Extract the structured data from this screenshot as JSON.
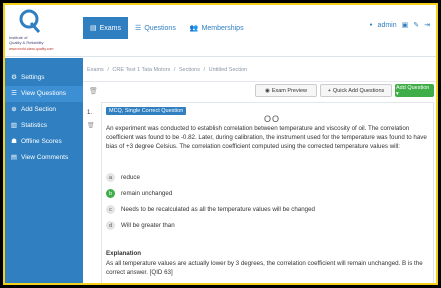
{
  "logo": {
    "line1": "Institute of",
    "line2": "Quality & Reliability",
    "url": "www.world-class-quality.com"
  },
  "nav": {
    "items": [
      {
        "label": "Exams",
        "icon": "clipboard-icon",
        "active": true
      },
      {
        "label": "Questions",
        "icon": "list-icon",
        "active": false
      },
      {
        "label": "Memberships",
        "icon": "users-icon",
        "active": false
      }
    ]
  },
  "user": {
    "name": "admin"
  },
  "sidebar": {
    "items": [
      {
        "label": "Settings",
        "icon": "gear-icon",
        "active": false
      },
      {
        "label": "View Questions",
        "icon": "list-icon",
        "active": true
      },
      {
        "label": "Add Section",
        "icon": "plus-circle-icon",
        "active": false
      },
      {
        "label": "Statistics",
        "icon": "chart-icon",
        "active": false
      },
      {
        "label": "Offline Scores",
        "icon": "users-icon",
        "active": false
      },
      {
        "label": "View Comments",
        "icon": "comment-icon",
        "active": false
      }
    ]
  },
  "breadcrumb": [
    "Exams",
    "/",
    "CRE Test 1 Tata Motors",
    "/",
    "Sections",
    "/",
    "Untitled Section"
  ],
  "toolbar": {
    "preview_label": "Exam Preview",
    "quick_add_label": "Quick Add Questions",
    "add_question_label": "Add Question ▾"
  },
  "question": {
    "number": "1.",
    "type_badge": "MCQ, Single Correct Question",
    "glyph": "OO",
    "text": "An experiment was conducted to establish correlation between temperature and viscosity of oil. The correlation coefficient was found to be -0.82. Later, during calibration, the instrument used for the temperature was found to have bias of +3 degree Celsius. The correlation coefficient computed using the corrected temperature values will:",
    "options": [
      {
        "letter": "a",
        "text": "reduce",
        "correct": false
      },
      {
        "letter": "b",
        "text": "remain unchanged",
        "correct": true
      },
      {
        "letter": "c",
        "text": "Needs to be recalculated as all the temperature values will be changed",
        "correct": false
      },
      {
        "letter": "d",
        "text": "Will be greater than",
        "correct": false
      }
    ],
    "explanation_title": "Explanation",
    "explanation_text": "As all temperature values are actually lower by 3 degrees, the correlation coefficient will remain unchanged. B is the correct answer. [QID 63]"
  },
  "colors": {
    "primary": "#2f7fc1",
    "success": "#3fae49",
    "frame_border": "#f4d21c"
  }
}
